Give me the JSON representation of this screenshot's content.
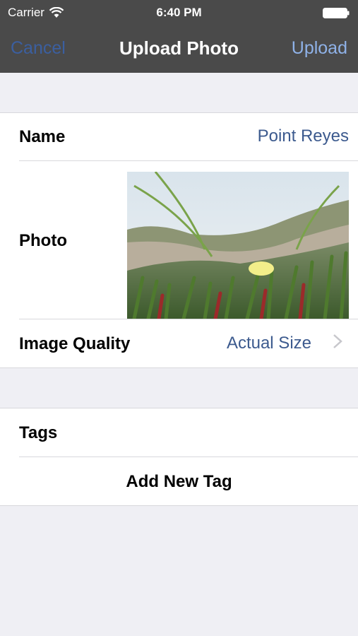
{
  "status_bar": {
    "carrier": "Carrier",
    "time": "6:40 PM",
    "icons": [
      "wifi-icon",
      "battery-icon"
    ]
  },
  "nav": {
    "cancel": "Cancel",
    "title": "Upload Photo",
    "upload": "Upload"
  },
  "form": {
    "name_label": "Name",
    "name_value": "Point Reyes",
    "photo_label": "Photo",
    "quality_label": "Image Quality",
    "quality_value": "Actual Size"
  },
  "tags": {
    "label": "Tags",
    "add": "Add New Tag"
  },
  "colors": {
    "nav_bg": "#4a4a4a",
    "value_blue": "#3c5a8e",
    "upload_blue": "#8fb2e8",
    "background": "#efeff4"
  }
}
